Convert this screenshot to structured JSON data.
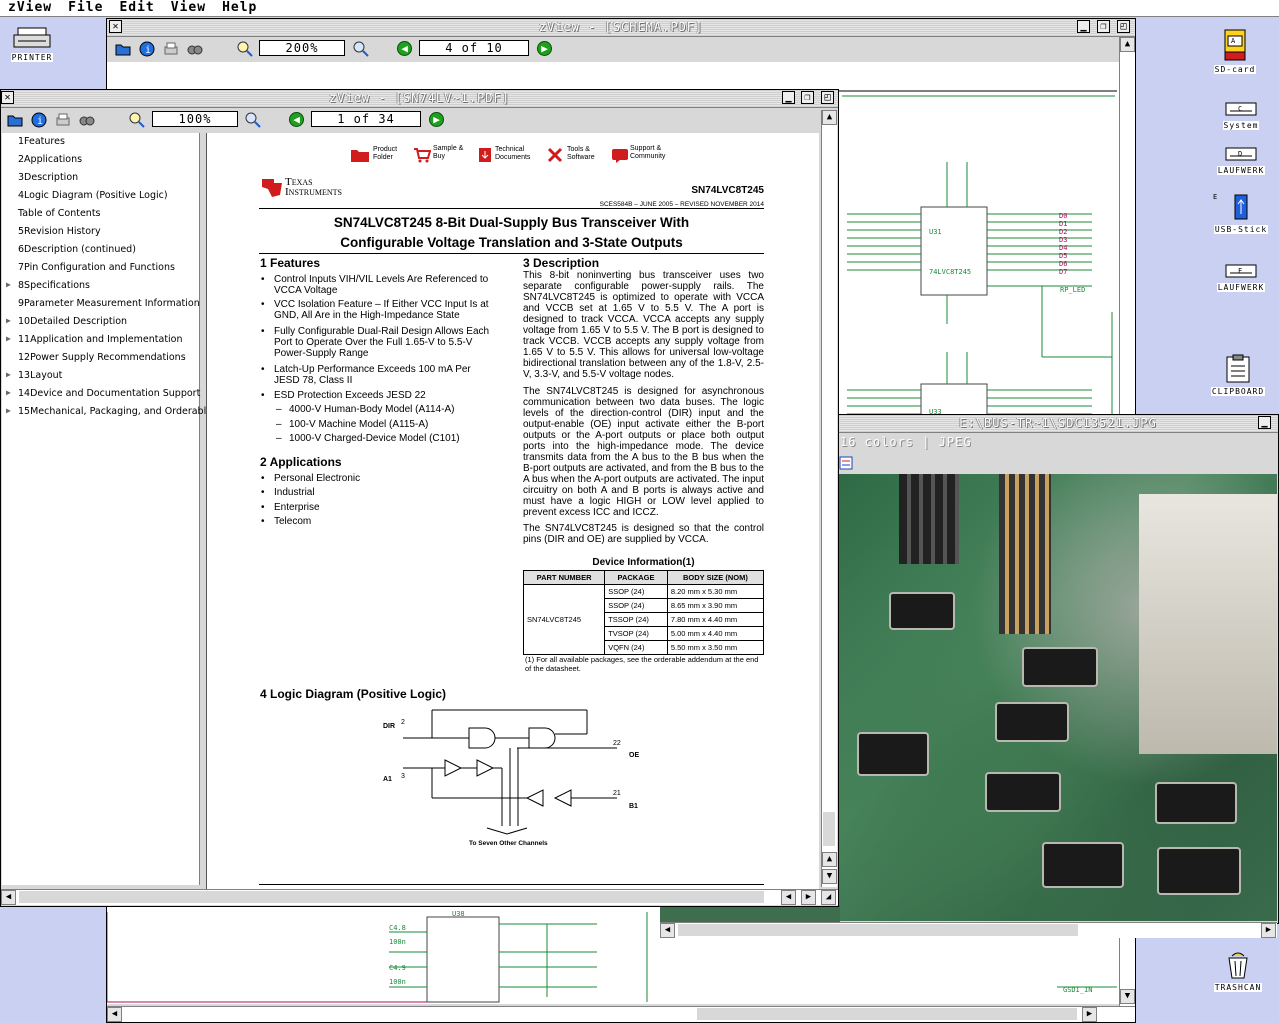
{
  "menubar": {
    "items": [
      "zView",
      "File",
      "Edit",
      "View",
      "Help"
    ]
  },
  "desktop": {
    "icons": [
      {
        "label": "PRINTER"
      },
      {
        "label": "SD-card",
        "badge": "A"
      },
      {
        "label": "System",
        "badge": "C"
      },
      {
        "label": "LAUFWERK",
        "badge": "D"
      },
      {
        "label": "USB-Stick",
        "badge": "E"
      },
      {
        "label": "LAUFWERK",
        "badge": "F"
      },
      {
        "label": "CLIPBOARD"
      },
      {
        "label": "TRASHCAN"
      }
    ]
  },
  "win_schema": {
    "title": "zView - [SCHEMA.PDF]",
    "zoom": "200%",
    "page": "4 of 10"
  },
  "win_main": {
    "title": "zView - [SN74LV~1.PDF]",
    "zoom": "100%",
    "page": "1 of 34",
    "outline": [
      "1Features",
      "2Applications",
      "3Description",
      "4Logic Diagram (Positive Logic)",
      "Table of Contents",
      "5Revision History",
      "6Description (continued)",
      "7Pin Configuration and Functions",
      "8Specifications",
      "9Parameter Measurement Information",
      "10Detailed Description",
      "11Application and Implementation",
      "12Power Supply Recommendations",
      "13Layout",
      "14Device and Documentation Support",
      "15Mechanical, Packaging, and Orderable"
    ]
  },
  "pdf": {
    "top_links": [
      {
        "l1": "Product",
        "l2": "Folder"
      },
      {
        "l1": "Sample &",
        "l2": "Buy"
      },
      {
        "l1": "Technical",
        "l2": "Documents"
      },
      {
        "l1": "Tools &",
        "l2": "Software"
      },
      {
        "l1": "Support &",
        "l2": "Community"
      }
    ],
    "brand_l1": "Texas",
    "brand_l2": "Instruments",
    "part": "SN74LVC8T245",
    "doc_ref": "SCES584B – JUNE 2005 – REVISED NOVEMBER 2014",
    "title_l1": "SN74LVC8T245 8-Bit Dual-Supply Bus Transceiver With",
    "title_l2": "Configurable Voltage Translation and 3-State Outputs",
    "features_h": "1   Features",
    "features": [
      "Control Inputs VIH/VIL Levels Are Referenced to VCCA Voltage",
      "VCC Isolation Feature – If Either VCC Input Is at GND, All Are in the High-Impedance State",
      "Fully Configurable Dual-Rail Design Allows Each Port to Operate Over the Full 1.65-V to 5.5-V Power-Supply Range",
      "Latch-Up Performance Exceeds 100 mA Per JESD 78, Class II",
      "ESD Protection Exceeds JESD 22"
    ],
    "esd": [
      "4000-V Human-Body Model (A114-A)",
      "100-V Machine Model (A115-A)",
      "1000-V Charged-Device Model (C101)"
    ],
    "apps_h": "2   Applications",
    "apps": [
      "Personal Electronic",
      "Industrial",
      "Enterprise",
      "Telecom"
    ],
    "desc_h": "3   Description",
    "desc_p1": "This 8-bit noninverting bus transceiver uses two separate configurable power-supply rails. The SN74LVC8T245 is optimized to operate with VCCA and VCCB set at 1.65 V to 5.5 V. The A port is designed to track VCCA. VCCA accepts any supply voltage from 1.65 V to 5.5 V. The B port is designed to track VCCB. VCCB accepts any supply voltage from 1.65 V to 5.5 V. This allows for universal low-voltage bidirectional translation between any of the 1.8-V, 2.5-V, 3.3-V, and 5.5-V voltage nodes.",
    "desc_p2": "The SN74LVC8T245 is designed for asynchronous communication between two data buses. The logic levels of the direction-control (DIR) input and the output-enable (OE) input activate either the B-port outputs or the A-port outputs or place both output ports into the high-impedance mode. The device transmits data from the A bus to the B bus when the B-port outputs are activated, and from the B bus to the A bus when the A-port outputs are activated. The input circuitry on both A and B ports is always active and must have a logic HIGH or LOW level applied to prevent excess ICC and ICCZ.",
    "desc_p3": "The SN74LVC8T245 is designed so that the control pins (DIR and OE) are supplied by VCCA.",
    "devinfo_h": "Device Information(1)",
    "devinfo_cols": [
      "PART NUMBER",
      "PACKAGE",
      "BODY SIZE (NOM)"
    ],
    "devinfo_part": "SN74LVC8T245",
    "devinfo_rows": [
      [
        "SSOP (24)",
        "8.20 mm x 5.30 mm"
      ],
      [
        "SSOP (24)",
        "8.65 mm x 3.90 mm"
      ],
      [
        "TSSOP (24)",
        "7.80 mm x 4.40 mm"
      ],
      [
        "TVSOP (24)",
        "5.00 mm x 4.40 mm"
      ],
      [
        "VQFN (24)",
        "5.50 mm x 3.50 mm"
      ]
    ],
    "devinfo_note": "(1)  For all available packages, see the orderable addendum at the end of the datasheet.",
    "logic_h": "4   Logic Diagram (Positive Logic)",
    "logic_labels": {
      "dir": "DIR",
      "a1": "A1",
      "b1": "B1",
      "oe": "OE",
      "p2": "2",
      "p3": "3",
      "p22": "22",
      "p21": "21",
      "bottom": "To Seven Other Channels"
    }
  },
  "win_image": {
    "title": "E:\\BUS-TR~1\\SDC13521.JPG",
    "info": "16 colors | JPEG"
  },
  "schematic": {
    "u31": "U31",
    "u31_part": "74LVC8T245",
    "u33": "U33",
    "u38": "U38",
    "net": "RP_LED",
    "net2": "GSDI_IN",
    "left_pins": [
      "D0",
      "D1",
      "D2",
      "D3",
      "D4",
      "D5",
      "D6",
      "D7"
    ],
    "caps": [
      "C4.8",
      "100n",
      "C4.9",
      "100n"
    ]
  },
  "colors": {
    "desktop": "#c9d0f2",
    "schematic_line": "#1a8a3a",
    "schematic_label": "#b01060",
    "nav_green": "#1fa11f"
  }
}
